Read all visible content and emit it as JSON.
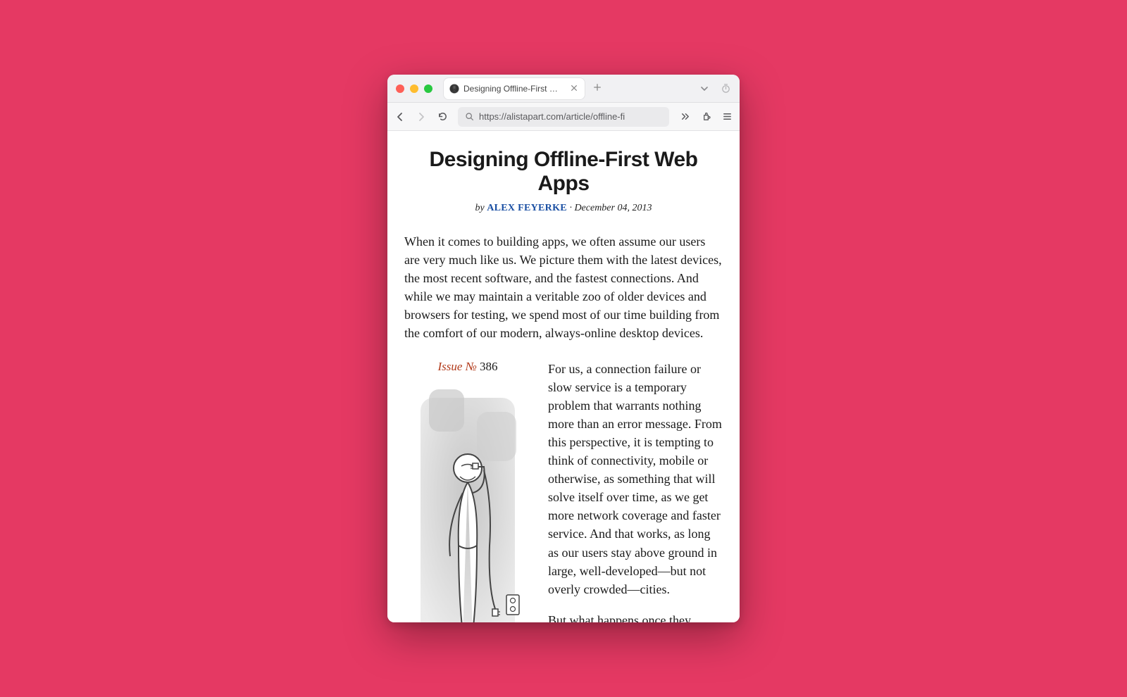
{
  "browser": {
    "tab_title": "Designing Offline-First Web App…",
    "url": "https://alistapart.com/article/offline-fi"
  },
  "article": {
    "title": "Designing Offline-First Web Apps",
    "byline_by": "by ",
    "author": "ALEX FEYERKE",
    "separator": " · ",
    "date": "December 04, 2013",
    "intro": "When it comes to building apps, we often assume our users are very much like us. We picture them with the latest devices, the most recent software, and the fastest connections. And while we may maintain a veritable zoo of older devices and browsers for testing, we spend most of our time building from the comfort of our modern, always-online desktop devices.",
    "issue_prefix": "Issue № ",
    "issue_number": "386",
    "para2": "For us, a connection failure or slow service is a temporary problem that warrants nothing more than an error message. From this perspective, it is tempting to think of connectivity, mobile or otherwise, as something that will solve itself over time, as we get more network coverage and faster service. And that works, as long as our users stay above ground in large, well-developed—but not overly crowded—cities.",
    "para3": "But what happens once they descend into the subway, board a plane, travel over land a bit, or go live in the countryside? Or when"
  }
}
